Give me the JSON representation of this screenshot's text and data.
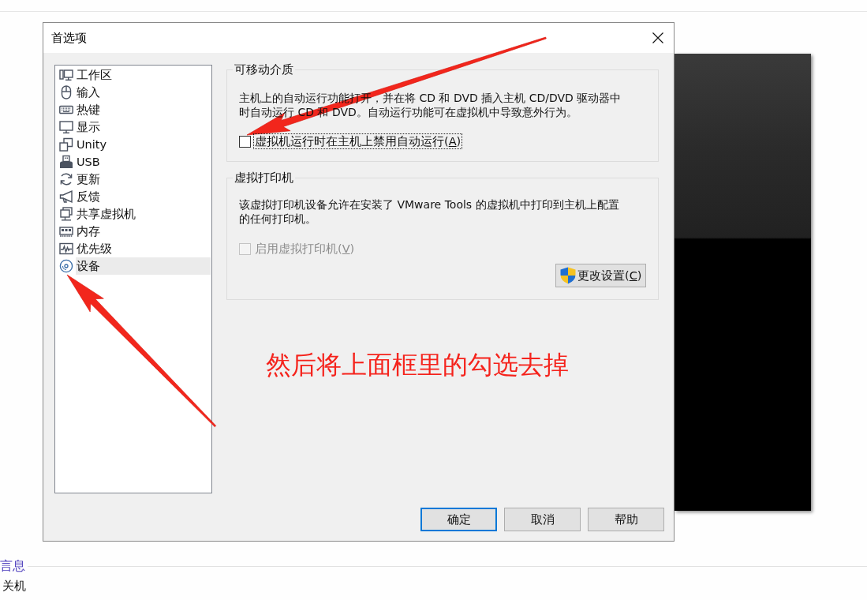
{
  "dialog": {
    "title": "首选项"
  },
  "sidebar": {
    "items": [
      {
        "label": "工作区",
        "selected": false
      },
      {
        "label": "输入",
        "selected": false
      },
      {
        "label": "热键",
        "selected": false
      },
      {
        "label": "显示",
        "selected": false
      },
      {
        "label": "Unity",
        "selected": false
      },
      {
        "label": "USB",
        "selected": false
      },
      {
        "label": "更新",
        "selected": false
      },
      {
        "label": "反馈",
        "selected": false
      },
      {
        "label": "共享虚拟机",
        "selected": false
      },
      {
        "label": "内存",
        "selected": false
      },
      {
        "label": "优先级",
        "selected": false
      },
      {
        "label": "设备",
        "selected": true
      }
    ]
  },
  "removable_media": {
    "title": "可移动介质",
    "description_lines": [
      "主机上的自动运行功能打开，并在将 CD 和 DVD 插入主机 CD/DVD 驱动器中",
      "时自动运行 CD 和 DVD。自动运行功能可在虚拟机中导致意外行为。"
    ],
    "checkbox": {
      "label": "虚拟机运行时在主机上禁用自动运行(A)",
      "checked": false,
      "disabled": false,
      "focused": true
    }
  },
  "virtual_printer": {
    "title": "虚拟打印机",
    "description_lines": [
      "该虚拟打印机设备允许在安装了 VMware Tools 的虚拟机中打印到主机上配置",
      "的任何打印机。"
    ],
    "checkbox": {
      "label": "启用虚拟打印机(V)",
      "checked": false,
      "disabled": true,
      "focused": false
    },
    "button": {
      "label": "更改设置(C)"
    }
  },
  "annotation": {
    "text": "然后将上面框里的勾选去掉"
  },
  "buttons": [
    {
      "label": "确定",
      "default": true
    },
    {
      "label": "取消",
      "default": false
    },
    {
      "label": "帮助",
      "default": false
    }
  ],
  "page_below": {
    "heading": "言息",
    "text": "关机"
  }
}
